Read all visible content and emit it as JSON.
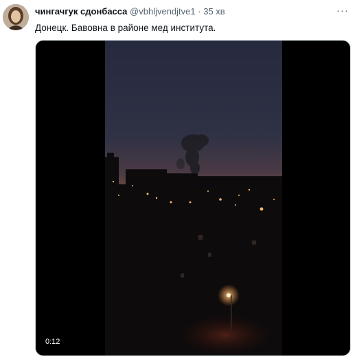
{
  "tweet": {
    "author_name": "чингачгук сдонбасса",
    "handle": "@vbhljvendjtve1",
    "separator": "·",
    "time": "35 хв",
    "text": "Донецк. Бавовна в районе мед института.",
    "more_icon": "more-horizontal-icon"
  },
  "media": {
    "duration": "0:12"
  }
}
